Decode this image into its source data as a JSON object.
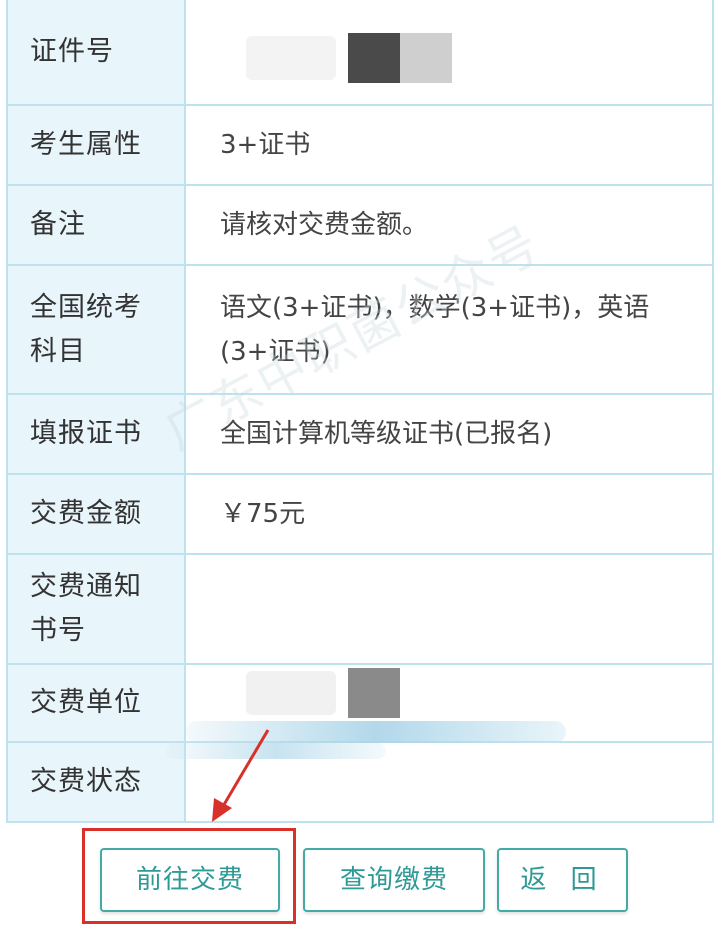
{
  "rows": [
    {
      "label": "证件号",
      "value": ""
    },
    {
      "label": "考生属性",
      "value": "3+证书"
    },
    {
      "label": "备注",
      "value": "请核对交费金额。"
    },
    {
      "label": "全国统考科目",
      "value": "语文(3+证书)，数学(3+证书)，英语(3+证书)"
    },
    {
      "label": "填报证书",
      "value": "全国计算机等级证书(已报名)"
    },
    {
      "label": "交费金额",
      "value": "￥75元"
    },
    {
      "label": "交费通知书号",
      "value": ""
    },
    {
      "label": "交费单位",
      "value": ""
    },
    {
      "label": "交费状态",
      "value": ""
    }
  ],
  "buttons": {
    "pay": "前往交费",
    "query": "查询缴费",
    "back": "返 回"
  },
  "watermark": "广东中职菌公众号",
  "colors": {
    "label_bg": "#e8f5fa",
    "border": "#bfe3ee",
    "button_text": "#2e9a96",
    "highlight": "#d9302a"
  }
}
